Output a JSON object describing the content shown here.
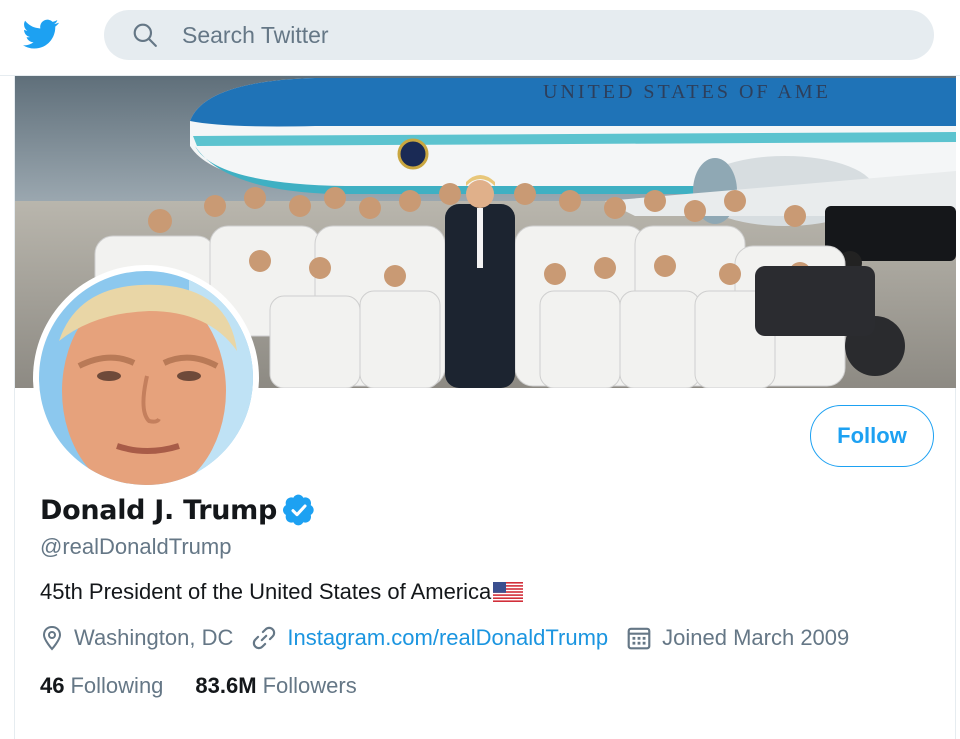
{
  "search": {
    "placeholder": "Search Twitter"
  },
  "profile": {
    "name": "Donald J. Trump",
    "handle": "@realDonaldTrump",
    "bio": "45th President of the United States of America",
    "location": "Washington, DC",
    "website": "Instagram.com/realDonaldTrump",
    "joined": "Joined March 2009",
    "following_count": "46",
    "following_label": "Following",
    "followers_count": "83.6M",
    "followers_label": "Followers",
    "follow_label": "Follow",
    "banner_text": "UNITED STATES OF AME"
  },
  "icons": {
    "logo": "twitter-bird-icon",
    "search": "search-icon",
    "verified": "verified-badge-icon",
    "flag": "us-flag-icon",
    "location": "location-pin-icon",
    "link": "link-icon",
    "calendar": "calendar-icon"
  },
  "colors": {
    "brand": "#1da1f2",
    "link": "#1b95e0",
    "secondary_text": "#657786",
    "search_bg": "#e6ecf0"
  }
}
